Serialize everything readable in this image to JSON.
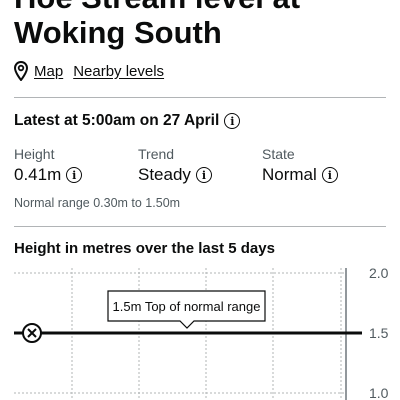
{
  "page": {
    "title": "Hoe Stream level at Woking South"
  },
  "links": {
    "map_icon": "map-pin-icon",
    "map": "Map",
    "nearby": "Nearby levels"
  },
  "latest": {
    "heading": "Latest at 5:00am on 27 April",
    "info_icon": "i"
  },
  "stats": {
    "height": {
      "label": "Height",
      "value": "0.41m"
    },
    "trend": {
      "label": "Trend",
      "value": "Steady"
    },
    "state": {
      "label": "State",
      "value": "Normal"
    }
  },
  "normal_range": "Normal range 0.30m to 1.50m",
  "chart": {
    "heading": "Height in metres over the last 5 days",
    "colors": {
      "line": "#0b0c0c",
      "grid": "#b1b4b6",
      "text": "#505a5f"
    }
  },
  "chart_data": {
    "type": "line",
    "title": "Height in metres over the last 5 days",
    "ylabel": "",
    "xlabel": "",
    "y_ticks": [
      {
        "value": 2.0,
        "label": "2.0"
      },
      {
        "value": 1.5,
        "label": "1.5"
      },
      {
        "value": 1.0,
        "label": "1.0"
      }
    ],
    "ylim": [
      0.95,
      2.05
    ],
    "grid": true,
    "reference_lines": [
      {
        "value": 1.5,
        "label": "1.5m Top of normal range",
        "marker": "close-icon"
      }
    ]
  }
}
